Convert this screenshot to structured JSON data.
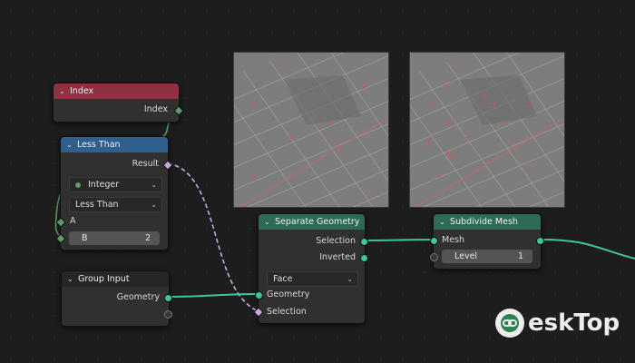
{
  "nodes": {
    "index": {
      "title": "Index",
      "output": "Index",
      "header_color": "#8c3042"
    },
    "less_than": {
      "title": "Less Than",
      "header_color": "#2f5f8c",
      "output": "Result",
      "data_type": "Integer",
      "operation": "Less Than",
      "input_a": "A",
      "input_b_label": "B",
      "input_b_value": "2"
    },
    "group_input": {
      "title": "Group Input",
      "output": "Geometry"
    },
    "separate_geometry": {
      "title": "Separate Geometry",
      "header_color": "#2e6b55",
      "outputs": [
        "Selection",
        "Inverted"
      ],
      "domain": "Face",
      "inputs": [
        "Geometry",
        "Selection"
      ]
    },
    "subdivide_mesh": {
      "title": "Subdivide Mesh",
      "header_color": "#2e6b55",
      "input": "Mesh",
      "level_label": "Level",
      "level_value": "1"
    }
  },
  "viewport_left": {
    "labels": [
      "1",
      "0",
      "2",
      "3",
      "3"
    ]
  },
  "viewport_right": {
    "labels": [
      "9",
      "8",
      "13",
      "12",
      "14",
      "11",
      "10",
      "6",
      "7",
      "5",
      "4"
    ]
  },
  "watermark": {
    "text": "eskTop",
    "icon": "link-icon"
  },
  "colors": {
    "geometry_link": "#3fc59e",
    "field_link": "#c7a6e0",
    "background": "#1d1d1d"
  }
}
